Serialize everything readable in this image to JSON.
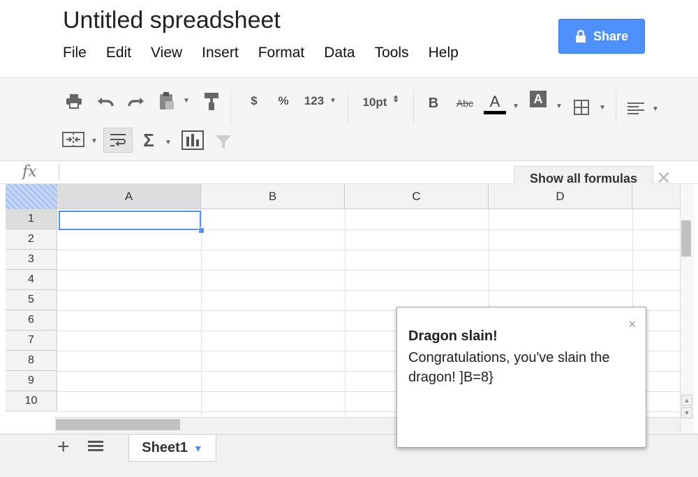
{
  "document": {
    "title": "Untitled spreadsheet"
  },
  "menu": [
    "File",
    "Edit",
    "View",
    "Insert",
    "Format",
    "Data",
    "Tools",
    "Help"
  ],
  "share": {
    "label": "Share"
  },
  "toolbar": {
    "currency": "$",
    "percent": "%",
    "number_format": "123",
    "font_size": "10pt",
    "bold": "B",
    "strikethrough": "Abc",
    "text_color": "A",
    "fill_color": "A",
    "sum": "Σ"
  },
  "formula_bar": {
    "fx": "fx",
    "value": "",
    "show_all_formulas": "Show all formulas"
  },
  "grid": {
    "columns": [
      "A",
      "B",
      "C",
      "D"
    ],
    "rows": [
      "1",
      "2",
      "3",
      "4",
      "5",
      "6",
      "7",
      "8",
      "9",
      "10"
    ],
    "selected_cell": "A1"
  },
  "sheets": [
    {
      "name": "Sheet1"
    }
  ],
  "notification": {
    "title": "Dragon slain!",
    "body": "Congratulations, you've slain the dragon! ]B=8}",
    "close": "×"
  },
  "colors": {
    "accent": "#4d90fe",
    "selection": "#4d90fe"
  }
}
